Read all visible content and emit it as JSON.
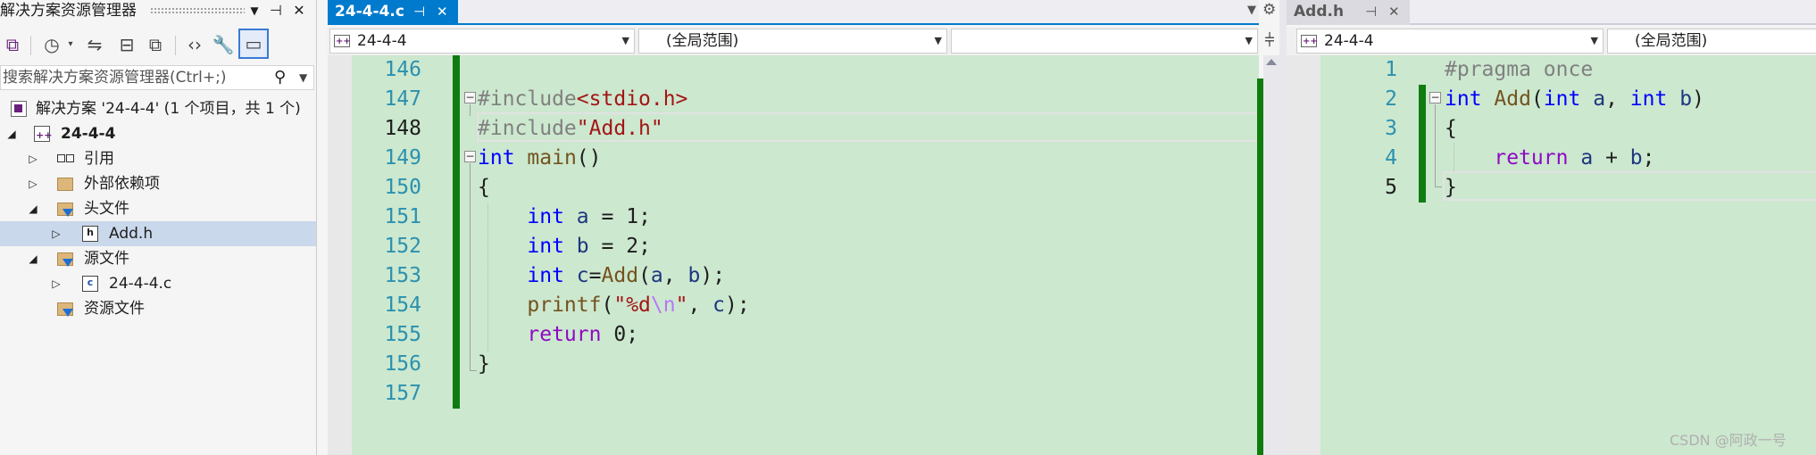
{
  "solution_explorer": {
    "title": "解决方案资源管理器",
    "title_buttons": [
      "▼",
      "⊣",
      "✕"
    ],
    "search_placeholder": "搜索解决方案资源管理器(Ctrl+;)",
    "tree": [
      {
        "label": "解决方案 '24-4-4' (1 个项目，共 1 个)",
        "icon": "solution-icon"
      },
      {
        "label": "24-4-4",
        "icon": "cpp-project-icon",
        "expanded": true
      },
      {
        "label": "引用",
        "icon": "references-icon"
      },
      {
        "label": "外部依赖项",
        "icon": "external-dependencies-icon"
      },
      {
        "label": "头文件",
        "icon": "filter-folder-icon",
        "expanded": true
      },
      {
        "label": "Add.h",
        "icon": "header-file-icon",
        "selected": true
      },
      {
        "label": "源文件",
        "icon": "filter-folder-icon",
        "expanded": true
      },
      {
        "label": "24-4-4.c",
        "icon": "c-file-icon"
      },
      {
        "label": "资源文件",
        "icon": "filter-folder-icon"
      }
    ]
  },
  "editor_left": {
    "tab_label": "24-4-4.c",
    "project_dropdown": "24-4-4",
    "scope_dropdown": "(全局范围)",
    "member_dropdown": "",
    "current_line": 148,
    "lines": [
      {
        "num": "146",
        "code": ""
      },
      {
        "num": "147",
        "code": "#include<stdio.h>"
      },
      {
        "num": "148",
        "code": "#include\"Add.h\""
      },
      {
        "num": "149",
        "code": "int main()"
      },
      {
        "num": "150",
        "code": "{"
      },
      {
        "num": "151",
        "code": "    int a = 1;"
      },
      {
        "num": "152",
        "code": "    int b = 2;"
      },
      {
        "num": "153",
        "code": "    int c=Add(a, b);"
      },
      {
        "num": "154",
        "code": "    printf(\"%d\\n\", c);"
      },
      {
        "num": "155",
        "code": "    return 0;"
      },
      {
        "num": "156",
        "code": "}"
      },
      {
        "num": "157",
        "code": ""
      }
    ]
  },
  "editor_right": {
    "tab_label": "Add.h",
    "project_dropdown": "24-4-4",
    "scope_dropdown": "(全局范围)",
    "current_line": 5,
    "lines": [
      {
        "num": "1",
        "code": "#pragma once"
      },
      {
        "num": "2",
        "code": "int Add(int a, int b)"
      },
      {
        "num": "3",
        "code": "{"
      },
      {
        "num": "4",
        "code": "    return a + b;"
      },
      {
        "num": "5",
        "code": "}"
      }
    ]
  },
  "watermark": "CSDN @阿政一号",
  "colors": {
    "editor_bg": "#cce8cf",
    "accent": "#007acc",
    "change_bar": "#107c10",
    "keyword": "#0000ff",
    "string": "#a31515",
    "preprocessor": "#808080",
    "function": "#74531f",
    "control_keyword": "#8f08c4",
    "line_number": "#2b91af"
  }
}
